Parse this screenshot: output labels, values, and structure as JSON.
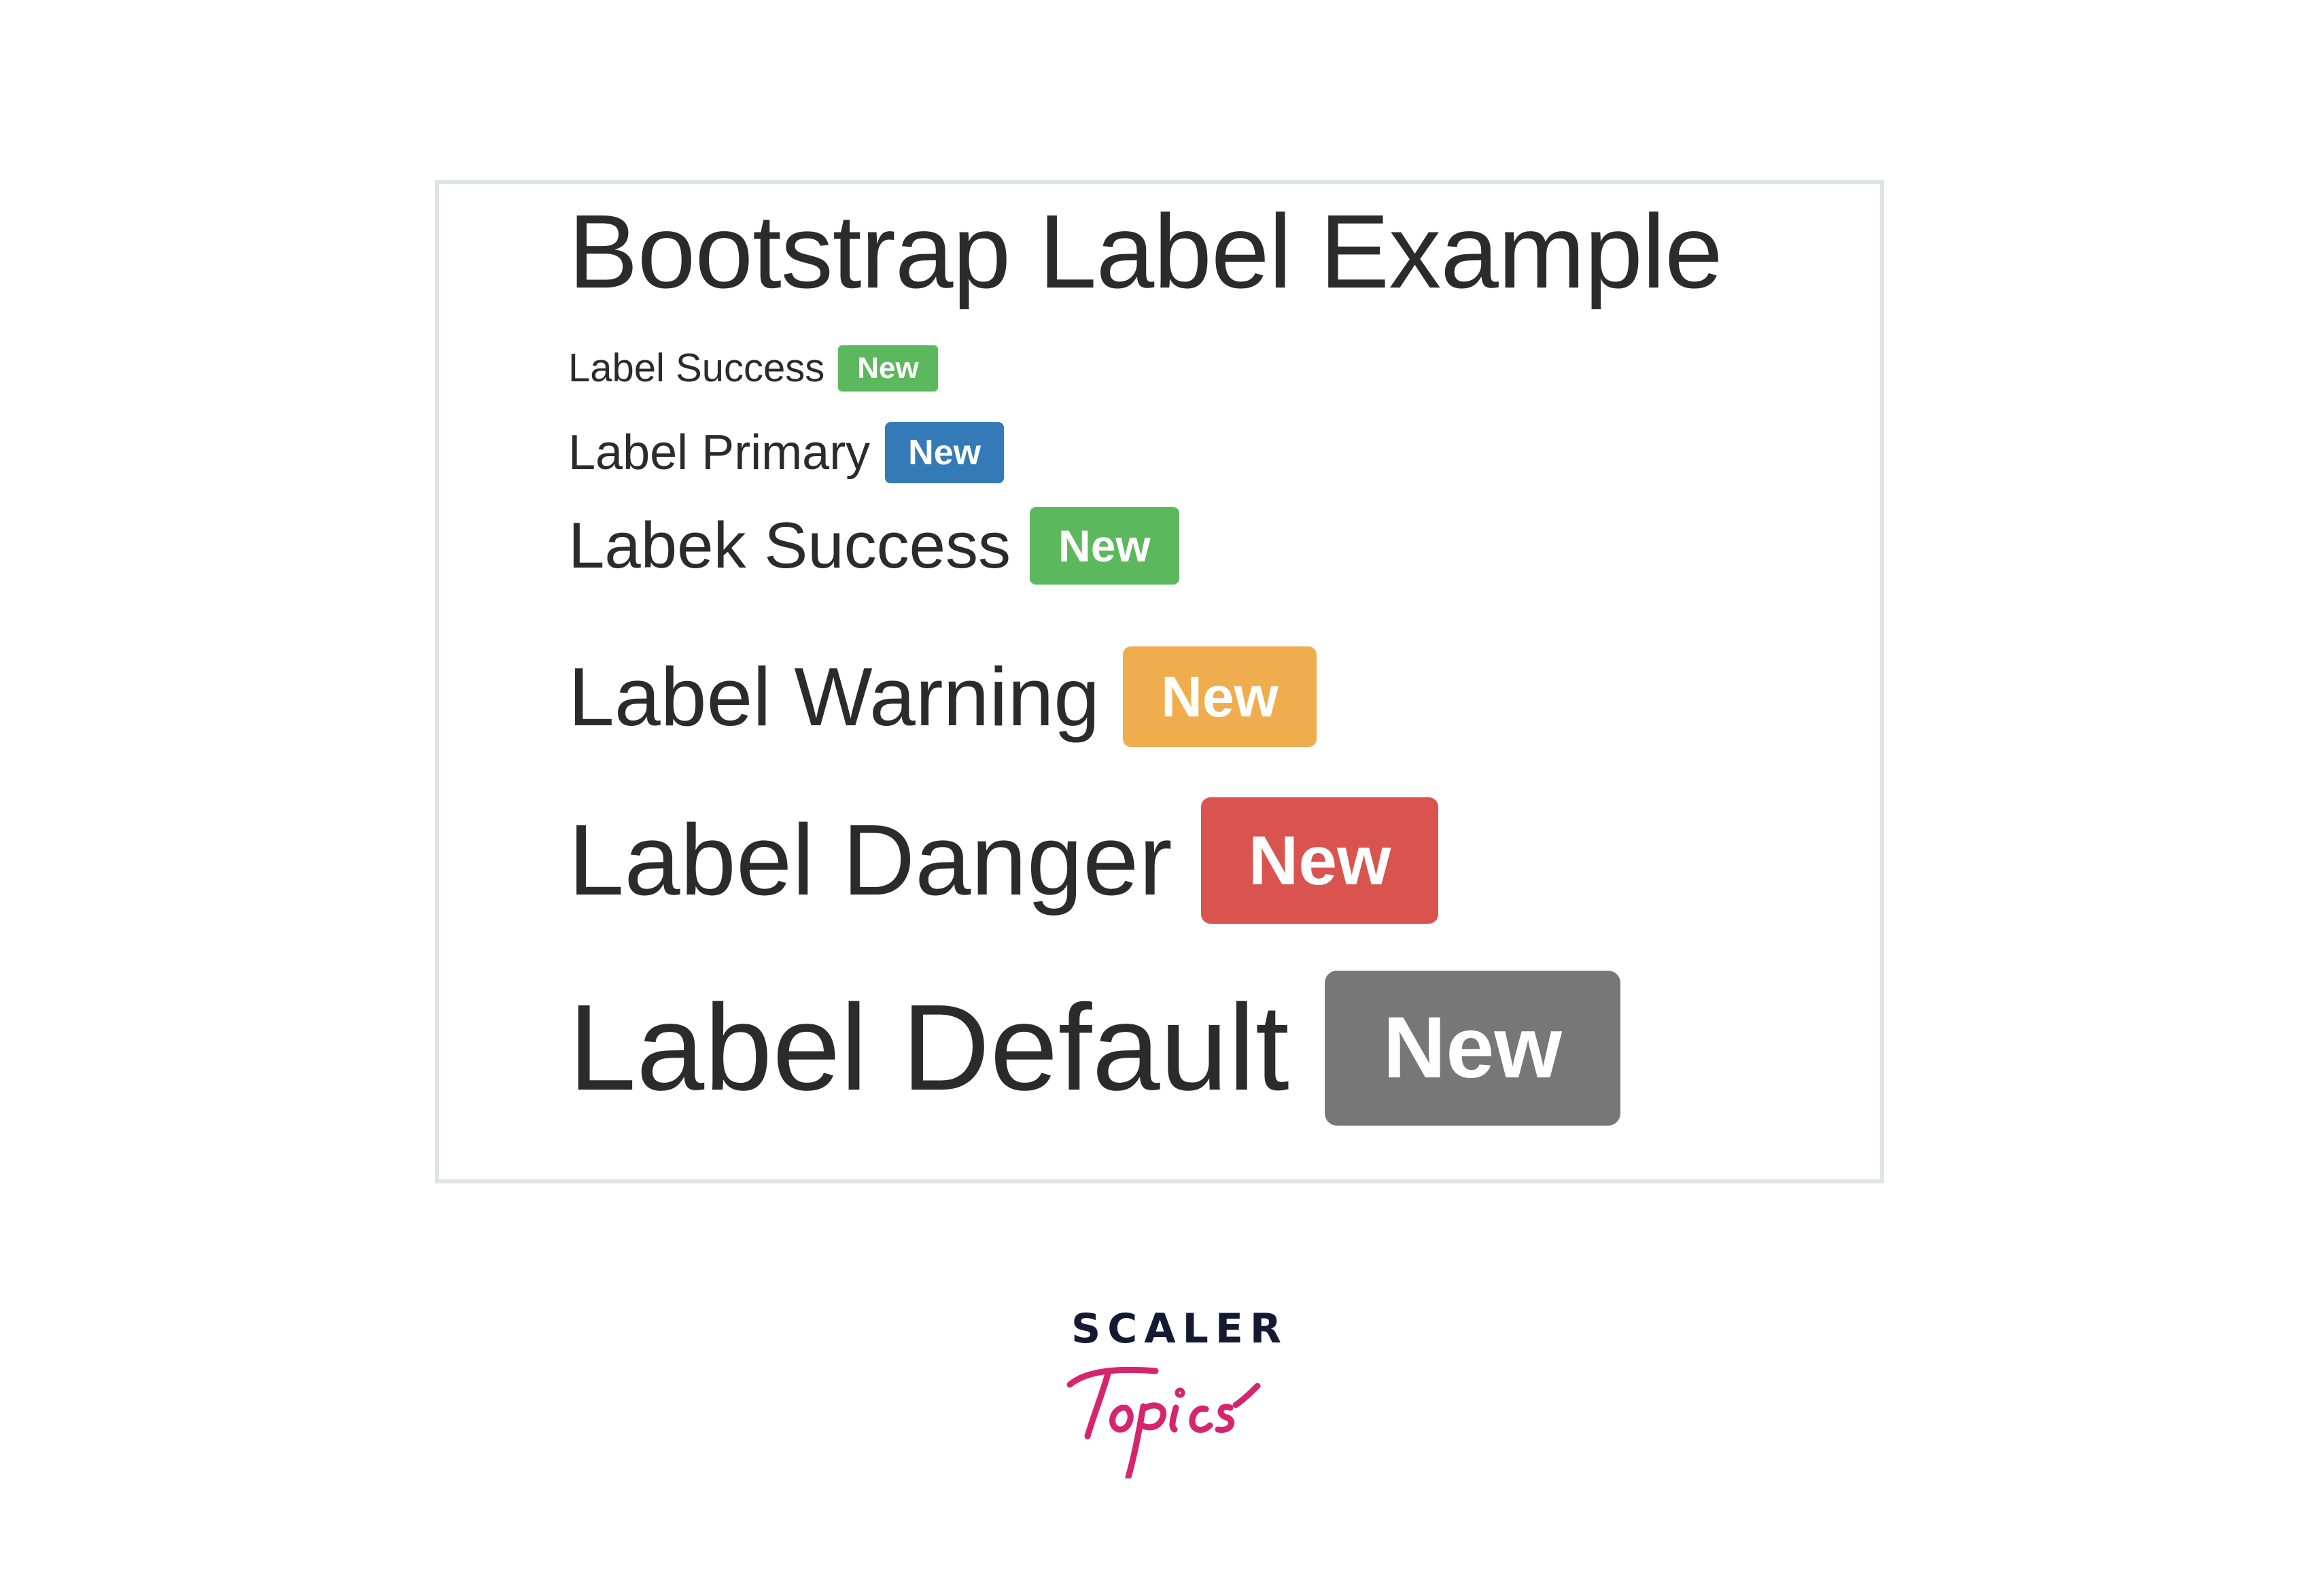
{
  "page": {
    "title": "Bootstrap Label Example"
  },
  "rows": [
    {
      "level": "h6",
      "label": "Label Success",
      "badge": "New",
      "variant": "success",
      "color": "#5cb85c"
    },
    {
      "level": "h5",
      "label": "Label Primary",
      "badge": "New",
      "variant": "primary",
      "color": "#337ab7"
    },
    {
      "level": "h4",
      "label": "Labek Success",
      "badge": "New",
      "variant": "success",
      "color": "#5cb85c"
    },
    {
      "level": "h3",
      "label": "Label Warning",
      "badge": "New",
      "variant": "warning",
      "color": "#f0ad4e"
    },
    {
      "level": "h2",
      "label": "Label Danger",
      "badge": "New",
      "variant": "danger",
      "color": "#d9534f"
    },
    {
      "level": "h1",
      "label": "Label Default",
      "badge": "New",
      "variant": "default",
      "color": "#777777"
    }
  ],
  "branding": {
    "brand_top": "SCALER",
    "brand_bottom": "Topics",
    "colors": {
      "brand_top": "#141a33",
      "brand_bottom": "#d6246e"
    }
  },
  "colors": {
    "text": "#2b2b2b",
    "frame_border": "#dfe4e5"
  }
}
